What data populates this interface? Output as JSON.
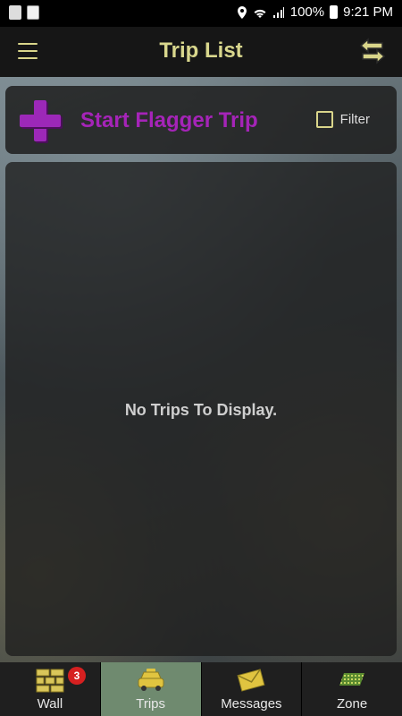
{
  "status_bar": {
    "battery": "100%",
    "time": "9:21 PM"
  },
  "app_bar": {
    "title": "Trip List"
  },
  "start_card": {
    "label": "Start Flagger Trip",
    "filter_label": "Filter",
    "filter_checked": false
  },
  "trips": {
    "empty_message": "No Trips To Display.",
    "items": []
  },
  "tabs": [
    {
      "label": "Wall",
      "badge": "3",
      "icon": "wall-icon"
    },
    {
      "label": "Trips",
      "icon": "taxi-icon",
      "active": true
    },
    {
      "label": "Messages",
      "icon": "envelope-icon"
    },
    {
      "label": "Zone",
      "icon": "zone-icon"
    }
  ],
  "colors": {
    "accent": "#d9d78d",
    "start_trip": "#a524b8",
    "active_tab": "#6f8a6f",
    "badge": "#d62020"
  }
}
